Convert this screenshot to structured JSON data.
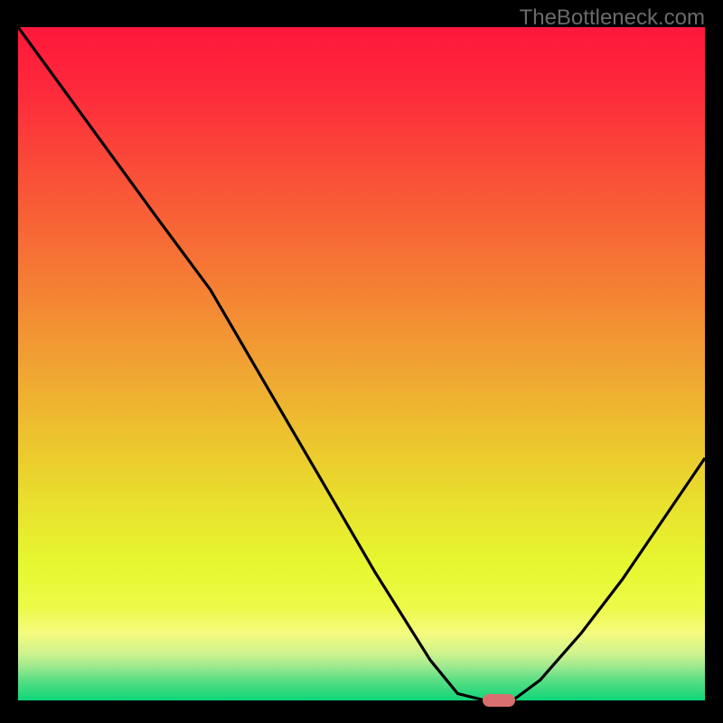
{
  "watermark": "TheBottleneck.com",
  "chart_data": {
    "type": "line",
    "title": "",
    "xlabel": "",
    "ylabel": "",
    "xlim": [
      0,
      100
    ],
    "ylim": [
      0,
      100
    ],
    "grid": false,
    "curve": [
      {
        "x": 0,
        "y": 100
      },
      {
        "x": 10,
        "y": 86
      },
      {
        "x": 20,
        "y": 72
      },
      {
        "x": 28,
        "y": 61
      },
      {
        "x": 36,
        "y": 47
      },
      {
        "x": 44,
        "y": 33
      },
      {
        "x": 52,
        "y": 19
      },
      {
        "x": 60,
        "y": 6
      },
      {
        "x": 64,
        "y": 1
      },
      {
        "x": 68,
        "y": 0
      },
      {
        "x": 72,
        "y": 0
      },
      {
        "x": 76,
        "y": 3
      },
      {
        "x": 82,
        "y": 10
      },
      {
        "x": 88,
        "y": 18
      },
      {
        "x": 94,
        "y": 27
      },
      {
        "x": 100,
        "y": 36
      }
    ],
    "marker": {
      "x": 70,
      "y": 0
    },
    "gradient_stops": [
      {
        "pos": 0.0,
        "color": "#fe173b"
      },
      {
        "pos": 0.1,
        "color": "#fd2b3b"
      },
      {
        "pos": 0.2,
        "color": "#fa4939"
      },
      {
        "pos": 0.3,
        "color": "#f76636"
      },
      {
        "pos": 0.4,
        "color": "#f48434"
      },
      {
        "pos": 0.5,
        "color": "#f0a232"
      },
      {
        "pos": 0.6,
        "color": "#edc02f"
      },
      {
        "pos": 0.7,
        "color": "#e9de2d"
      },
      {
        "pos": 0.8,
        "color": "#e6f830"
      },
      {
        "pos": 0.86,
        "color": "#ecfa47"
      },
      {
        "pos": 0.9,
        "color": "#f5fb7d"
      },
      {
        "pos": 0.93,
        "color": "#cef38e"
      },
      {
        "pos": 0.95,
        "color": "#9de98e"
      },
      {
        "pos": 0.97,
        "color": "#5ade84"
      },
      {
        "pos": 1.0,
        "color": "#0fd579"
      }
    ]
  }
}
